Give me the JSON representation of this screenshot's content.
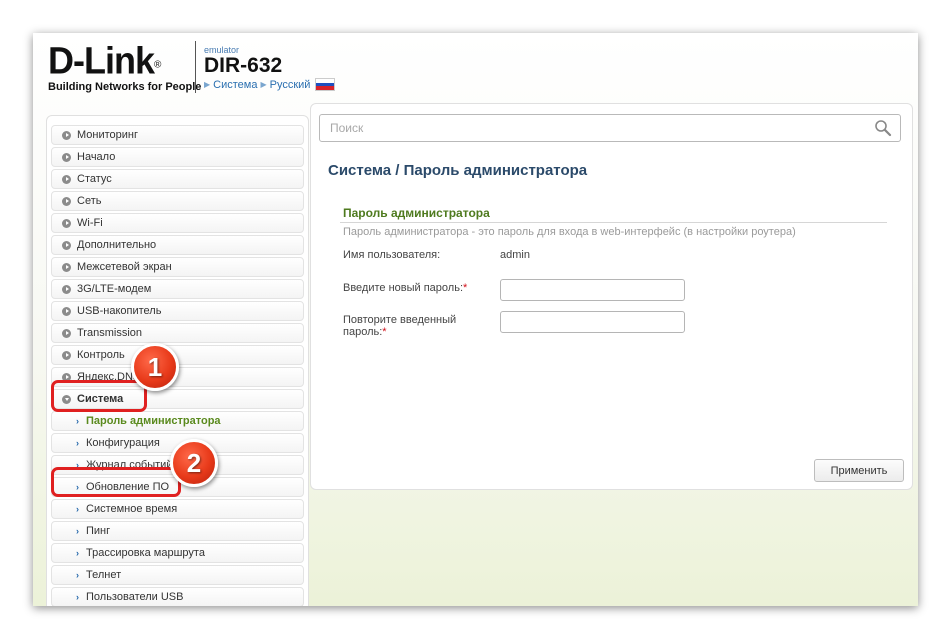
{
  "header": {
    "brand": "D-Link",
    "brand_mark": "®",
    "tagline": "Building Networks for People",
    "emulator_label": "emulator",
    "model": "DIR-632",
    "crumbs": [
      "Система",
      "Русский"
    ],
    "flag_colors": [
      "#ffffff",
      "#1f4fbf",
      "#d8232a"
    ]
  },
  "search": {
    "placeholder": "Поиск",
    "icon": "search-icon"
  },
  "sidebar": {
    "items": [
      {
        "label": "Мониторинг"
      },
      {
        "label": "Начало"
      },
      {
        "label": "Статус"
      },
      {
        "label": "Сеть"
      },
      {
        "label": "Wi-Fi"
      },
      {
        "label": "Дополнительно"
      },
      {
        "label": "Межсетевой экран"
      },
      {
        "label": "3G/LTE-модем"
      },
      {
        "label": "USB-накопитель"
      },
      {
        "label": "Transmission"
      },
      {
        "label": "Контроль"
      },
      {
        "label": "Яндекс.DNS"
      },
      {
        "label": "Система"
      }
    ],
    "sub_items": [
      {
        "label": "Пароль администратора"
      },
      {
        "label": "Конфигурация"
      },
      {
        "label": "Журнал событий"
      },
      {
        "label": "Обновление ПО"
      },
      {
        "label": "Системное время"
      },
      {
        "label": "Пинг"
      },
      {
        "label": "Трассировка маршрута"
      },
      {
        "label": "Телнет"
      },
      {
        "label": "Пользователи USB"
      }
    ]
  },
  "main": {
    "title_section": "Система /",
    "title_page": "Пароль администратора",
    "section_title": "Пароль администратора",
    "section_desc": "Пароль администратора - это пароль для входа в web-интерфейс (в настройки роутера)",
    "username_label": "Имя пользователя:",
    "username_value": "admin",
    "new_password_label": "Введите новый пароль:",
    "repeat_password_label_1": "Повторите введенный",
    "repeat_password_label_2": "пароль:",
    "required_mark": "*",
    "apply_label": "Применить"
  },
  "annotations": {
    "badge1": "1",
    "badge2": "2",
    "accent_color": "#e02020"
  }
}
